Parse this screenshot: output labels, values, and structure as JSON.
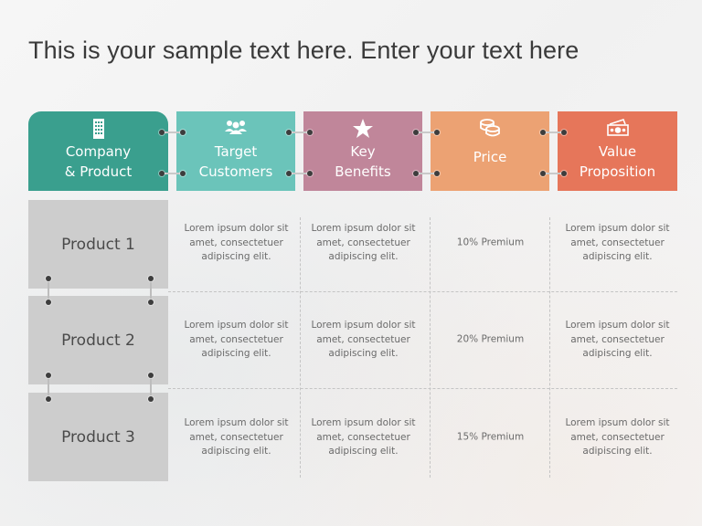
{
  "title": "This is your sample text here. Enter your text here",
  "headers": [
    {
      "line1": "Company",
      "line2": "& Product",
      "icon": "building-icon",
      "color": "#3a9f8e"
    },
    {
      "line1": "Target",
      "line2": "Customers",
      "icon": "users-icon",
      "color": "#6bc4ba"
    },
    {
      "line1": "Key",
      "line2": "Benefits",
      "icon": "star-icon",
      "color": "#c0869a"
    },
    {
      "line1": "",
      "line2": "Price",
      "icon": "coins-icon",
      "color": "#eca273"
    },
    {
      "line1": "Value",
      "line2": "Proposition",
      "icon": "money-icon",
      "color": "#e6765a"
    }
  ],
  "rows": [
    {
      "product": "Product 1",
      "target": "Lorem ipsum dolor sit amet, consectetuer adipiscing elit.",
      "benefits": "Lorem ipsum dolor sit amet, consectetuer adipiscing elit.",
      "price": "10% Premium",
      "value": "Lorem ipsum dolor sit amet, consectetuer adipiscing elit."
    },
    {
      "product": "Product 2",
      "target": "Lorem ipsum dolor sit amet, consectetuer adipiscing elit.",
      "benefits": "Lorem ipsum dolor sit amet, consectetuer adipiscing elit.",
      "price": "20% Premium",
      "value": "Lorem ipsum dolor sit amet, consectetuer adipiscing elit."
    },
    {
      "product": "Product 3",
      "target": "Lorem ipsum dolor sit amet, consectetuer adipiscing elit.",
      "benefits": "Lorem ipsum dolor sit amet, consectetuer adipiscing elit.",
      "price": "15% Premium",
      "value": "Lorem ipsum dolor sit amet, consectetuer adipiscing elit."
    }
  ]
}
